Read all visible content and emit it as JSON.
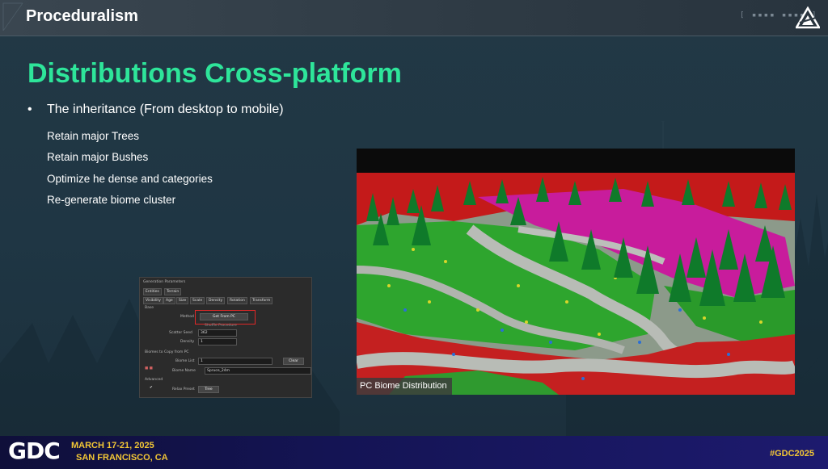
{
  "header": {
    "title": "Proceduralism",
    "decoration": "[ ▪▪▪▪ ▪▪▪▪ ]"
  },
  "slide": {
    "title": "Distributions Cross-platform",
    "bullet": "The inheritance (From desktop to mobile)",
    "subitems": [
      "Retain major Trees",
      "Retain major Bushes",
      "Optimize he dense and categories",
      "Re-generate biome cluster"
    ],
    "image_caption": "PC Biome Distribution"
  },
  "params_panel": {
    "title": "Generation Parameters",
    "top_tabs": [
      "Entities",
      "Terrain"
    ],
    "tabs": [
      "Visibility",
      "Age",
      "Size",
      "Scale",
      "Density",
      "Rotation",
      "Transform"
    ],
    "section_base": "Base",
    "method_label": "Method",
    "method_value": "Get From PC",
    "method_hint": "Shuffle Procedure",
    "seed_label": "Scatter Seed",
    "seed_value": "362",
    "density_label": "Density",
    "density_value": "1",
    "biomes_section": "Biomes to Copy from PC",
    "biome_list_label": "Biome List",
    "biome_list_value": "1",
    "clear_label": "Clear",
    "biome_name_label": "Biome Name",
    "biome_name_value": "Spruce_24m",
    "advanced_section": "Advanced",
    "relax_label": "Relax Preset",
    "relax_value": "Tree"
  },
  "footer": {
    "logo": "GDC",
    "date": "MARCH 17-21, 2025",
    "location": "SAN FRANCISCO, CA",
    "hashtag": "#GDC2025"
  },
  "colors": {
    "accent_green": "#2ee59a",
    "footer_gold": "#f3c735",
    "highlight_red": "#e02828"
  }
}
